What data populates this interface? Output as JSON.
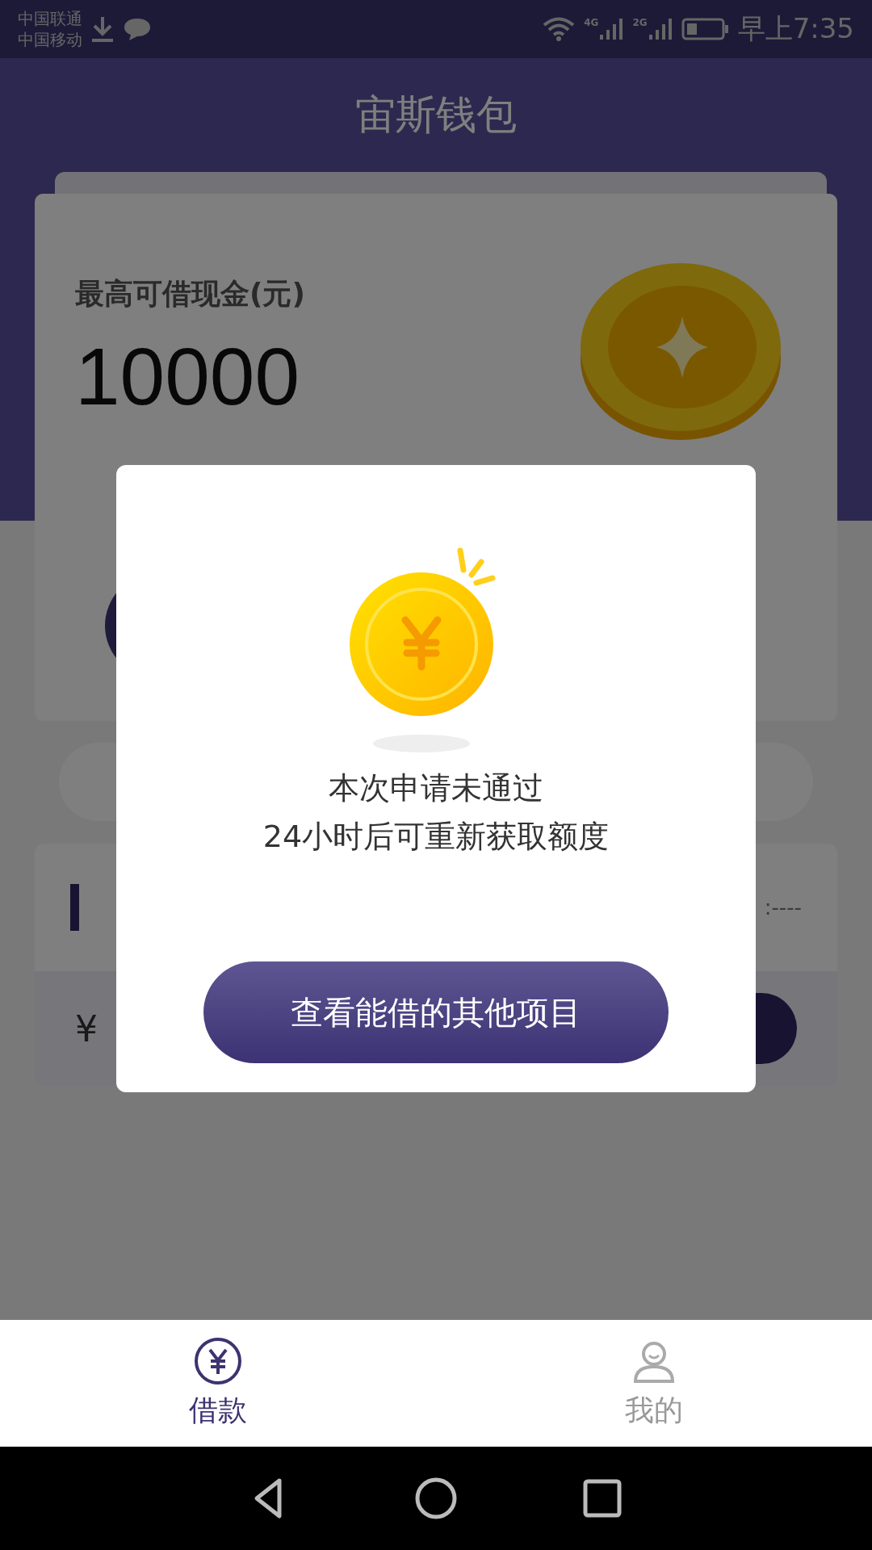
{
  "status_bar": {
    "carriers": [
      "中国联通",
      "中国移动"
    ],
    "network_labels": [
      "4G",
      "2G"
    ],
    "time": "早上7:35"
  },
  "header": {
    "title": "宙斯钱包"
  },
  "credit_card": {
    "label": "最高可借现金(元)",
    "amount": "10000"
  },
  "record_card": {
    "info_fragment": ":----",
    "currency": "¥"
  },
  "dialog": {
    "messages": [
      "本次申请未通过",
      "24小时后可重新获取额度"
    ],
    "button": "查看能借的其他项目"
  },
  "tab_bar": [
    {
      "label": "借款",
      "selected": true,
      "kind": "loan"
    },
    {
      "label": "我的",
      "selected": false,
      "kind": "profile"
    }
  ]
}
